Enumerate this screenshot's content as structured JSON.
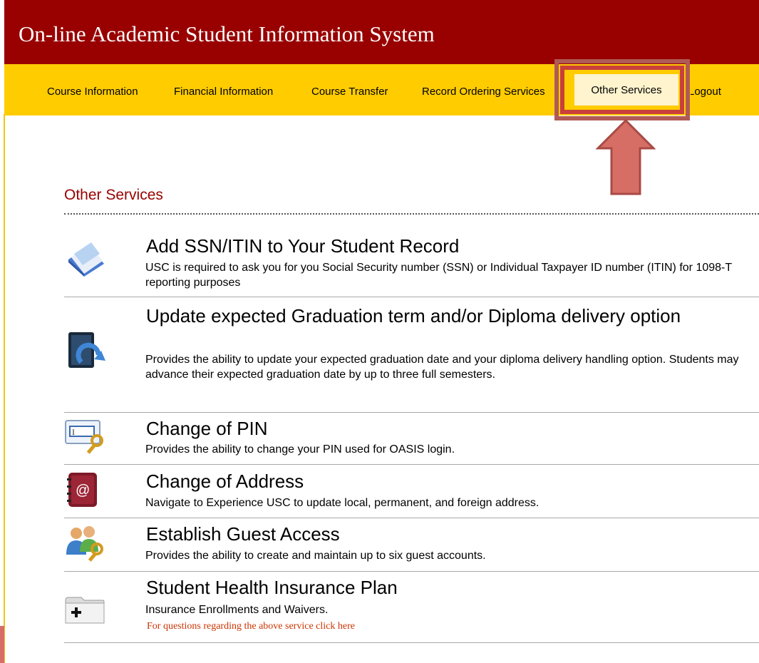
{
  "app": {
    "title": "On-line Academic Student Information System"
  },
  "nav": {
    "items": [
      {
        "label": "Course Information"
      },
      {
        "label": "Financial Information"
      },
      {
        "label": "Course Transfer"
      },
      {
        "label": "Record Ordering Services"
      },
      {
        "label": "Other Services"
      },
      {
        "label": "Logout"
      }
    ],
    "active_index": 4,
    "highlight_color": "#c9403a",
    "arrow_color": "#d76e66"
  },
  "page": {
    "section_title": "Other Services"
  },
  "services": [
    {
      "icon": "document-icon",
      "title": "Add SSN/ITIN to Your Student Record",
      "description": "USC is required to ask you for you Social Security number (SSN) or Individual Taxpayer ID number (ITIN) for 1098-T reporting purposes"
    },
    {
      "icon": "update-icon",
      "title": "Update expected Graduation term and/or Diploma delivery option",
      "description": "Provides the ability to update your expected graduation date and your diploma delivery handling option. Students may advance their expected graduation date by up to three full semesters."
    },
    {
      "icon": "pin-key-icon",
      "title": "Change of PIN",
      "description": "Provides the ability to change your PIN used for OASIS login."
    },
    {
      "icon": "address-book-icon",
      "title": "Change of Address",
      "description": "Navigate to Experience USC to update local, permanent, and foreign address."
    },
    {
      "icon": "guest-users-icon",
      "title": "Establish Guest Access",
      "description": "Provides the ability to create and maintain up to six guest accounts."
    },
    {
      "icon": "add-folder-icon",
      "title": "Student Health Insurance Plan",
      "description": "Insurance Enrollments and Waivers.",
      "link": "For questions regarding the above service click here"
    }
  ]
}
